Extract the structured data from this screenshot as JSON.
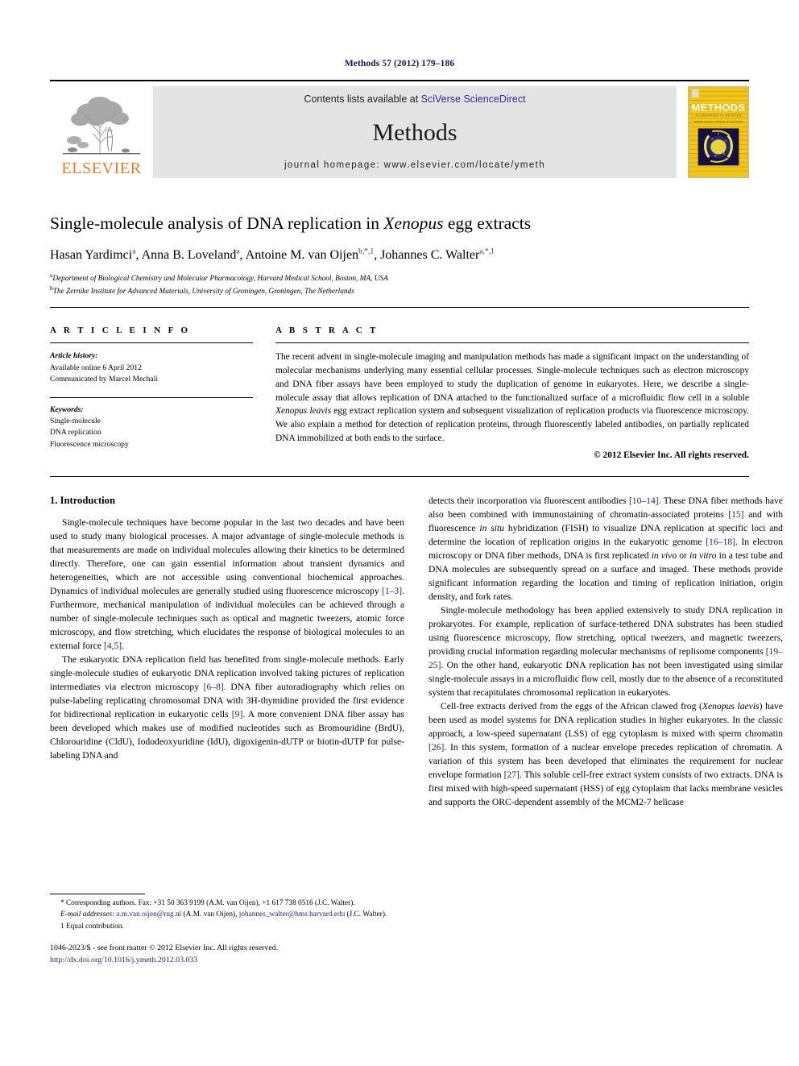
{
  "running_head": "Methods 57 (2012) 179–186",
  "masthead": {
    "contents_prefix": "Contents lists available at ",
    "contents_link": "SciVerse ScienceDirect",
    "journal_name": "Methods",
    "homepage": "journal homepage: www.elsevier.com/locate/ymeth",
    "publisher_word": "ELSEVIER",
    "cover_title": "METHODS",
    "cover_subtitle": "A COMPANION TO METHODS IN ENZYMOLOGY",
    "link_color": "#2b2f96",
    "publisher_color": "#eb7d24",
    "masthead_bg": "#e4e4e4",
    "cover_bg": "#f0c419"
  },
  "article": {
    "title_pre": "Single-molecule analysis of DNA replication in ",
    "title_italic": "Xenopus",
    "title_post": " egg extracts",
    "authors": "Hasan Yardimci a, Anna B. Loveland a, Antoine M. van Oijen b,*,1, Johannes C. Walter a,*,1",
    "affiliation_a": "Department of Biological Chemistry and Molecular Pharmacology, Harvard Medical School, Boston, MA, USA",
    "affiliation_b": "The Zernike Institute for Advanced Materials, University of Groningen, Groningen, The Netherlands"
  },
  "article_info": {
    "heading": "A R T I C L E    I N F O",
    "history_label": "Article history:",
    "history_lines": [
      "Available online 6 April 2012",
      "Communicated by Marcel Mechali"
    ],
    "keywords_label": "Keywords:",
    "keywords": [
      "Single-molecule",
      "DNA replication",
      "Fluorescence microscopy"
    ]
  },
  "abstract": {
    "heading": "A B S T R A C T",
    "text_part1": "The recent advent in single-molecule imaging and manipulation methods has made a significant impact on the understanding of molecular mechanisms underlying many essential cellular processes. Single-molecule techniques such as electron microscopy and DNA fiber assays have been employed to study the duplication of genome in eukaryotes. Here, we describe a single-molecule assay that allows replication of DNA attached to the functionalized surface of a microfluidic flow cell in a soluble ",
    "text_italic": "Xenopus leavis",
    "text_part2": " egg extract replication system and subsequent visualization of replication products via fluorescence microscopy. We also explain a method for detection of replication proteins, through fluorescently labeled antibodies, on partially replicated DNA immobilized at both ends to the surface.",
    "copyright": "© 2012 Elsevier Inc. All rights reserved."
  },
  "body": {
    "section_1_title": "1. Introduction",
    "left_para_1_a": "Single-molecule techniques have become popular in the last two decades and have been used to study many biological processes. A major advantage of single-molecule methods is that measurements are made on individual molecules allowing their kinetics to be determined directly. Therefore, one can gain essential information about transient dynamics and heterogeneities, which are not accessible using conventional biochemical approaches. Dynamics of individual molecules are generally studied using fluorescence microscopy ",
    "left_para_1_ref1": "[1–3]",
    "left_para_1_b": ". Furthermore, mechanical manipulation of individual molecules can be achieved through a number of single-molecule techniques such as optical and magnetic tweezers, atomic force microscopy, and flow stretching, which elucidates the response of biological molecules to an external force ",
    "left_para_1_ref2": "[4,5]",
    "left_para_1_c": ".",
    "left_para_2_a": "The eukaryotic DNA replication field has benefited from single-molecule methods. Early single-molecule studies of eukaryotic DNA replication involved taking pictures of replication intermediates via electron microscopy ",
    "left_para_2_ref1": "[6–8]",
    "left_para_2_b": ". DNA fiber autoradiography which relies on pulse-labeling replicating chromosomal DNA with 3H-thymidine provided the first evidence for bidirectional replication in eukaryotic cells ",
    "left_para_2_ref2": "[9]",
    "left_para_2_c": ". A more convenient DNA fiber assay has been developed which makes use of modified nucleotides such as Bromouridine (BrdU), Chlorouridine (CldU), Iododeoxyuridine (IdU), digoxigenin-dUTP or biotin-dUTP for pulse-labeling DNA and",
    "right_para_1_a": "detects their incorporation via fluorescent antibodies ",
    "right_para_1_ref1": "[10–14]",
    "right_para_1_b": ". These DNA fiber methods have also been combined with immunostaining of chromatin-associated proteins ",
    "right_para_1_ref2": "[15]",
    "right_para_1_c": " and with fluorescence ",
    "right_para_1_italic1": "in situ",
    "right_para_1_d": " hybridization (FISH) to visualize DNA replication at specific loci and determine the location of replication origins in the eukaryotic genome ",
    "right_para_1_ref3": "[16–18]",
    "right_para_1_e": ". In electron microscopy or DNA fiber methods, DNA is first replicated ",
    "right_para_1_italic2": "in vivo",
    "right_para_1_f": " or ",
    "right_para_1_italic3": "in vitro",
    "right_para_1_g": " in a test tube and DNA molecules are subsequently spread on a surface and imaged. These methods provide significant information regarding the location and timing of replication initiation, origin density, and fork rates.",
    "right_para_2_a": "Single-molecule methodology has been applied extensively to study DNA replication in prokaryotes. For example, replication of surface-tethered DNA substrates has been studied using fluorescence microscopy, flow stretching, optical tweezers, and magnetic tweezers, providing crucial information regarding molecular mechanisms of replisome components ",
    "right_para_2_ref1": "[19–25]",
    "right_para_2_b": ". On the other hand, eukaryotic DNA replication has not been investigated using similar single-molecule assays in a microfluidic flow cell, mostly due to the absence of a reconstituted system that recapitulates chromosomal replication in eukaryotes.",
    "right_para_3_a": "Cell-free extracts derived from the eggs of the African clawed frog (",
    "right_para_3_italic1": "Xenopus laevis",
    "right_para_3_b": ") have been used as model systems for DNA replication studies in higher eukaryotes. In the classic approach, a low-speed supernatant (LSS) of egg cytoplasm is mixed with sperm chromatin ",
    "right_para_3_ref1": "[26]",
    "right_para_3_c": ". In this system, formation of a nuclear envelope precedes replication of chromatin. A variation of this system has been developed that eliminates the requirement for nuclear envelope formation ",
    "right_para_3_ref2": "[27]",
    "right_para_3_d": ". This soluble cell-free extract system consists of two extracts. DNA is first mixed with high-speed supernatant (HSS) of egg cytoplasm that lacks membrane vesicles and supports the ORC-dependent assembly of the MCM2-7 helicase"
  },
  "footnotes": {
    "corresponding": "* Corresponding authors. Fax: +31 50 363 9199 (A.M. van Oijen), +1 617 738 0516 (J.C. Walter).",
    "email_label": "E-mail addresses:",
    "email_1": "a.m.van.oijen@rug.nl",
    "email_1_owner": " (A.M. van Oijen), ",
    "email_2": "johannes_walter@hms.harvard.edu",
    "email_2_owner": " (J.C. Walter).",
    "equal_contribution": "1  Equal contribution.",
    "issn_line": "1046-2023/$ - see front matter © 2012 Elsevier Inc. All rights reserved.",
    "doi_line": "http://dx.doi.org/10.1016/j.ymeth.2012.03.033"
  }
}
